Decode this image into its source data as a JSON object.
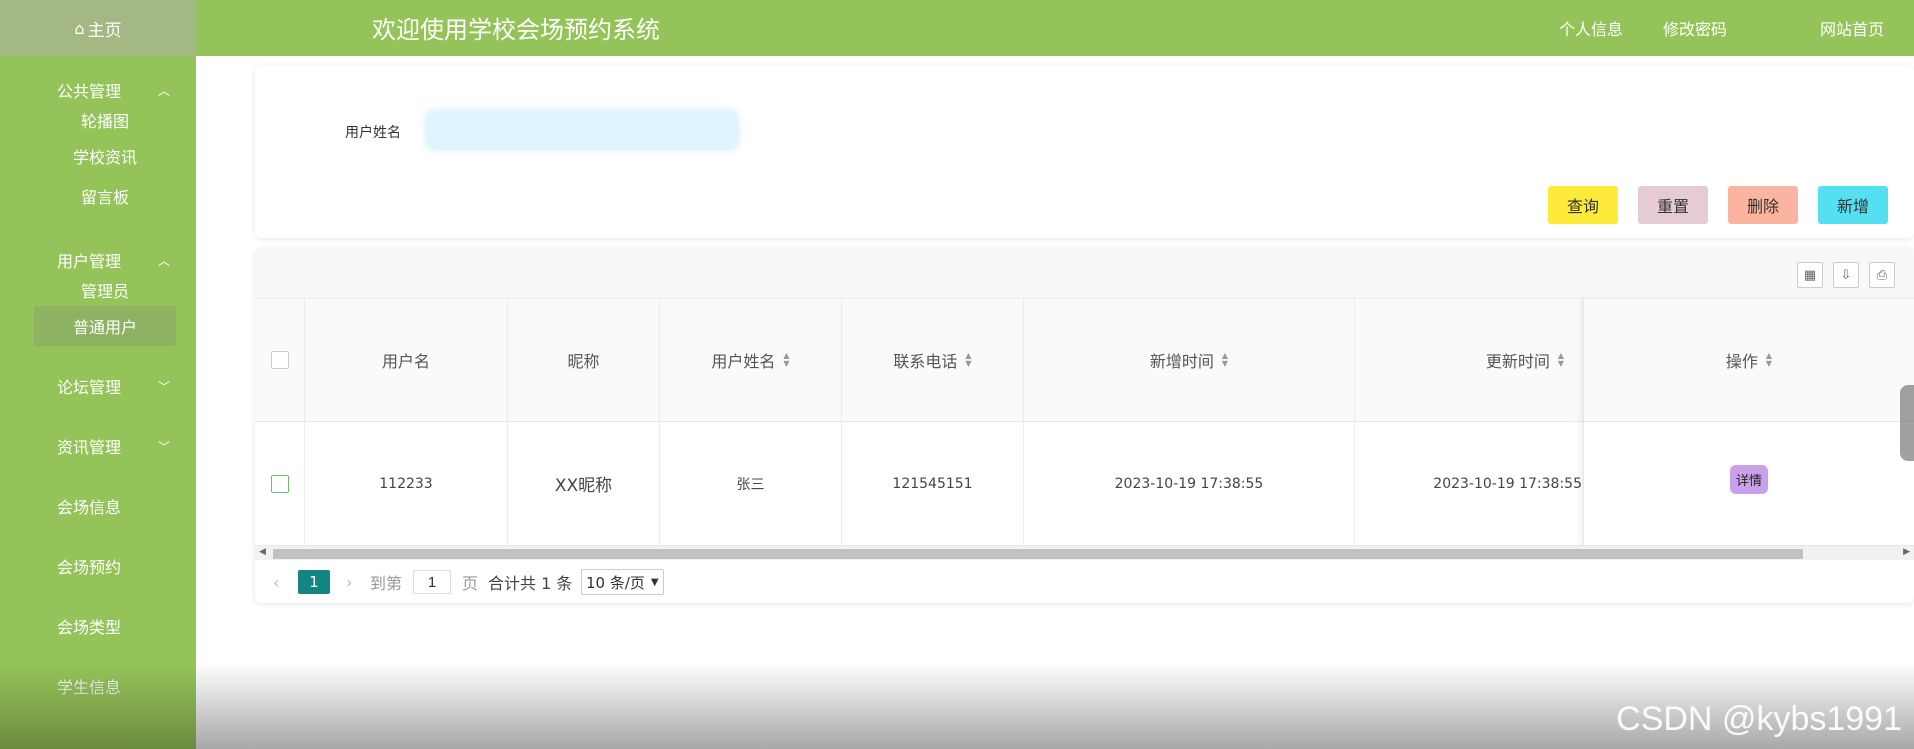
{
  "sidebar": {
    "home": "主页",
    "groups": [
      {
        "title": "公共管理",
        "items": [
          "轮播图",
          "学校资讯",
          "留言板"
        ]
      },
      {
        "title": "用户管理",
        "items": [
          "管理员",
          "普通用户"
        ]
      },
      {
        "title": "论坛管理"
      },
      {
        "title": "资讯管理"
      },
      {
        "title": "会场信息"
      },
      {
        "title": "会场预约"
      },
      {
        "title": "会场类型"
      },
      {
        "title": "学生信息"
      }
    ]
  },
  "header": {
    "title": "欢迎使用学校会场预约系统",
    "links": [
      "个人信息",
      "修改密码",
      "网站首页"
    ]
  },
  "search": {
    "label": "用户姓名",
    "placeholder": "",
    "buttons": {
      "query": "查询",
      "reset": "重置",
      "delete": "删除",
      "add": "新增"
    }
  },
  "table": {
    "columns": [
      "用户名",
      "昵称",
      "用户姓名",
      "联系电话",
      "新增时间",
      "更新时间",
      "操作"
    ],
    "rows": [
      {
        "username": "112233",
        "nickname": "XX昵称",
        "realname": "张三",
        "phone": "121545151",
        "created": "2023-10-19 17:38:55",
        "updated": "2023-10-19 17:38:55",
        "action": "详情"
      }
    ]
  },
  "pagination": {
    "current": "1",
    "goto_label": "到第",
    "goto_value": "1",
    "page_unit": "页",
    "total": "合计共 1 条",
    "page_size": "10 条/页"
  },
  "watermark": "CSDN @kybs1991",
  "colors": {
    "sidebar": "#94c459",
    "query_btn": "#fdea3a",
    "reset_btn": "#e6cbd3",
    "delete_btn": "#fbb4a0",
    "add_btn": "#55e0f2",
    "detail_btn": "#c9a0ea",
    "page_active": "#138585"
  }
}
